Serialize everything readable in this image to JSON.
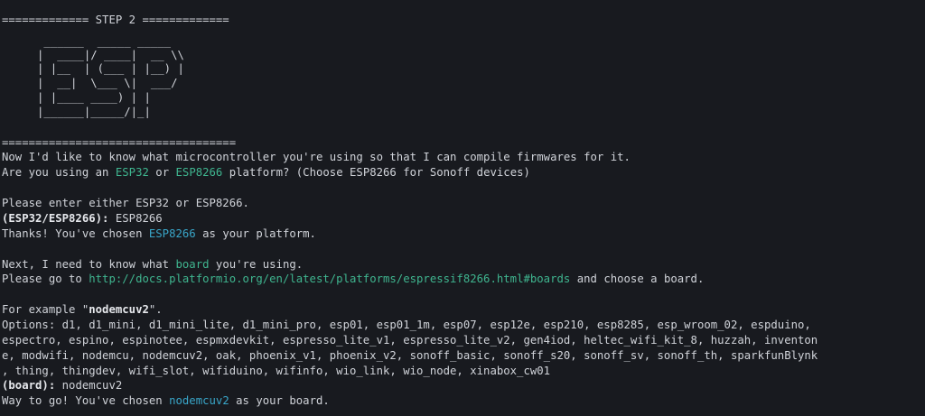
{
  "terminal": {
    "step_header": "============= STEP 2 =============",
    "ascii_art": [
      " ______  _____ _____  ",
      "|  ____|/ ____|  __ \\\\",
      "| |__  | (___ | |__) |",
      "|  __|  \\___ \\|  ___/ ",
      "| |____ ____) | |     ",
      "|______|_____/|_|     "
    ],
    "separator": "===================================",
    "intro_line1": "Now I'd like to know what microcontroller you're using so that I can compile firmwares for it.",
    "intro_line2_a": "Are you using an ",
    "intro_line2_esp32": "ESP32",
    "intro_line2_b": " or ",
    "intro_line2_esp8266": "ESP8266",
    "intro_line2_c": " platform? (Choose ESP8266 for Sonoff devices)",
    "enter_prompt": "Please enter either ESP32 or ESP8266.",
    "platform_prompt_label": "(ESP32/ESP8266):",
    "platform_prompt_value": " ESP8266",
    "thanks_a": "Thanks! You've chosen ",
    "thanks_platform": "ESP8266",
    "thanks_b": " as your platform.",
    "board_intro_a": "Next, I need to know what ",
    "board_intro_word": "board",
    "board_intro_b": " you're using.",
    "goto_a": "Please go to ",
    "goto_link": "http://docs.platformio.org/en/latest/platforms/espressif8266.html#boards",
    "goto_b": " and choose a board.",
    "example_a": "For example \"",
    "example_value": "nodemcuv2",
    "example_b": "\".",
    "options_line1": "Options: d1, d1_mini, d1_mini_lite, d1_mini_pro, esp01, esp01_1m, esp07, esp12e, esp210, esp8285, esp_wroom_02, espduino,",
    "options_line2": "espectro, espino, espinotee, espmxdevkit, espresso_lite_v1, espresso_lite_v2, gen4iod, heltec_wifi_kit_8, huzzah, inventon",
    "options_line3": "e, modwifi, nodemcu, nodemcuv2, oak, phoenix_v1, phoenix_v2, sonoff_basic, sonoff_s20, sonoff_sv, sonoff_th, sparkfunBlynk",
    "options_line4": ", thing, thingdev, wifi_slot, wifiduino, wifinfo, wio_link, wio_node, xinabox_cw01",
    "board_prompt_label": "(board):",
    "board_prompt_value": " nodemcuv2",
    "done_a": "Way to go! You've chosen ",
    "done_board": "nodemcuv2",
    "done_b": " as your board."
  }
}
